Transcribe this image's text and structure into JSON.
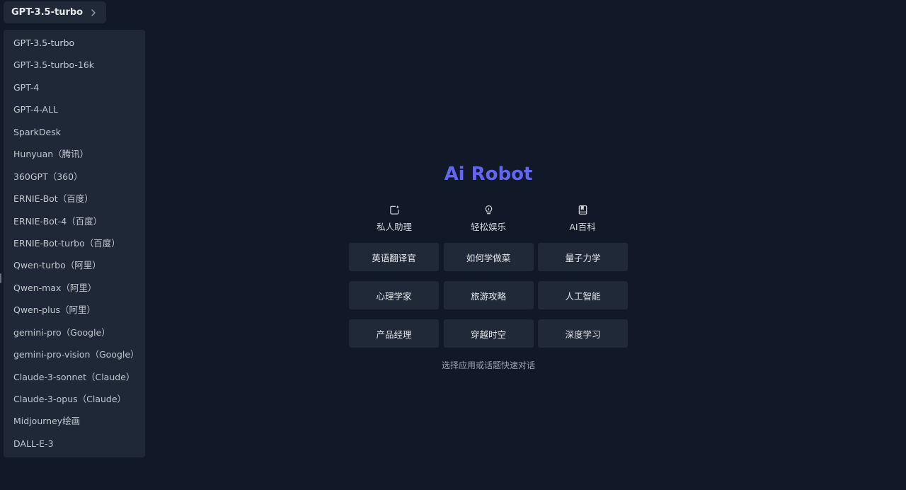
{
  "colors": {
    "background": "#111827",
    "panel": "#1f2937",
    "accent": "#6366f1",
    "text": "#d1d5db"
  },
  "header": {
    "selected_model": "GPT-3.5-turbo",
    "chevron_icon": "chevron-right-icon"
  },
  "dropdown": {
    "options": [
      "GPT-3.5-turbo",
      "GPT-3.5-turbo-16k",
      "GPT-4",
      "GPT-4-ALL",
      "SparkDesk",
      "Hunyuan（腾讯）",
      "360GPT（360）",
      "ERNIE-Bot（百度）",
      "ERNIE-Bot-4（百度）",
      "ERNIE-Bot-turbo（百度）",
      "Qwen-turbo（阿里）",
      "Qwen-max（阿里）",
      "Qwen-plus（阿里）",
      "gemini-pro（Google）",
      "gemini-pro-vision（Google）",
      "Claude-3-sonnet（Claude）",
      "Claude-3-opus（Claude）",
      "Midjourney绘画",
      "DALL-E-3"
    ]
  },
  "main": {
    "title": "Ai Robot",
    "categories": [
      {
        "label": "私人助理",
        "icon": "sparkle-edit-icon"
      },
      {
        "label": "轻松娱乐",
        "icon": "lightbulb-icon"
      },
      {
        "label": "AI百科",
        "icon": "book-icon"
      }
    ],
    "topics": [
      "英语翻译官",
      "如何学做菜",
      "量子力学",
      "心理学家",
      "旅游攻略",
      "人工智能",
      "产品经理",
      "穿越时空",
      "深度学习"
    ],
    "hint": "选择应用或话题快速对话"
  }
}
